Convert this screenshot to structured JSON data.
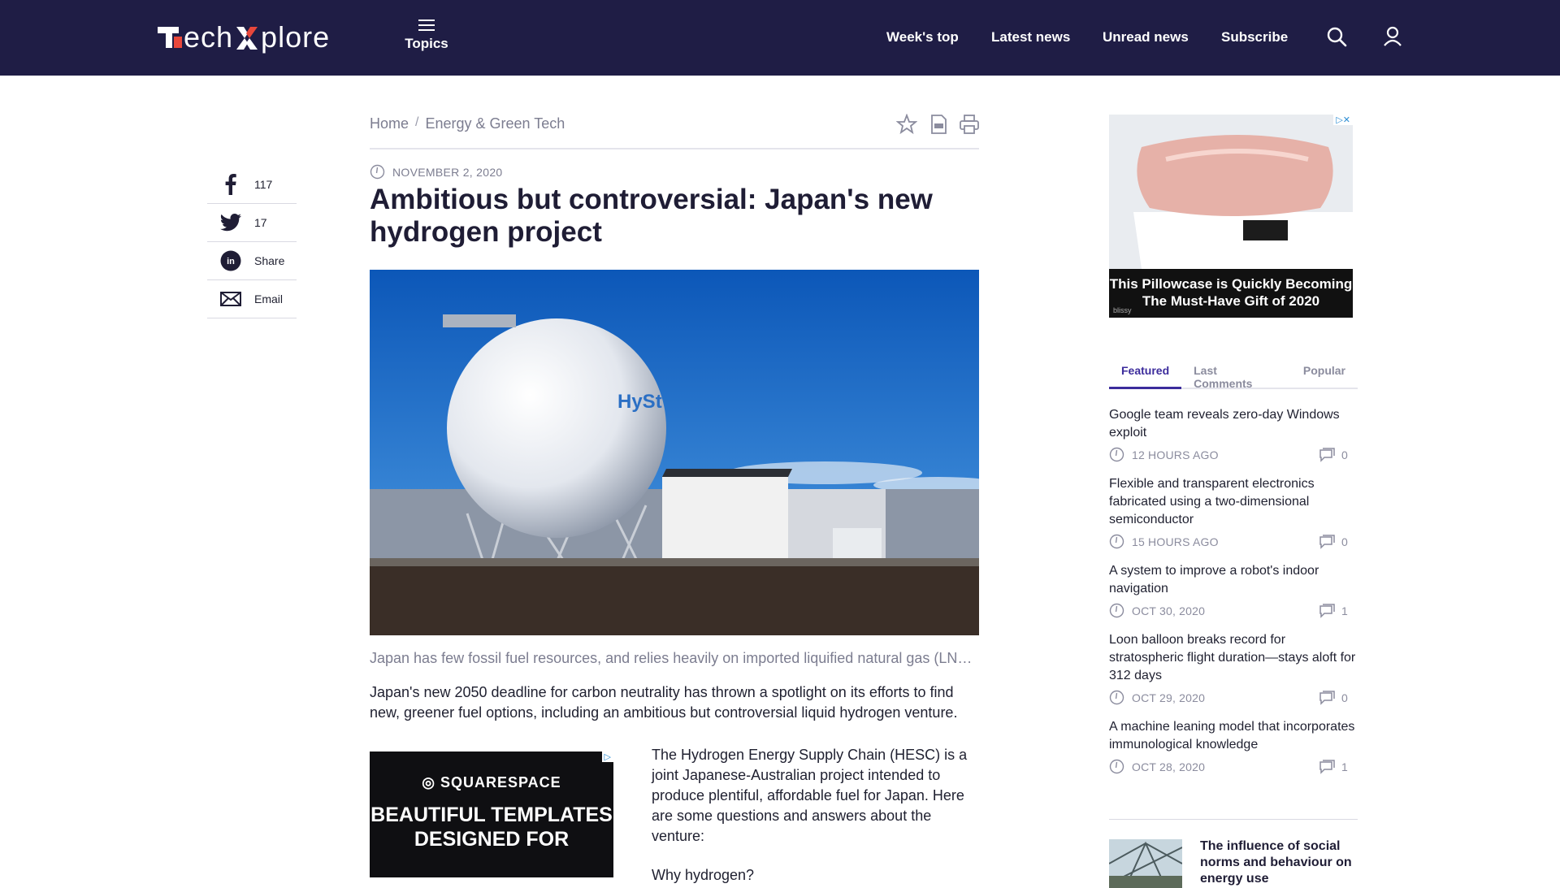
{
  "header": {
    "logo": {
      "part1": "ech",
      "part2": "plore"
    },
    "topics_label": "Topics",
    "nav": [
      "Week's top",
      "Latest news",
      "Unread news",
      "Subscribe"
    ]
  },
  "breadcrumb": {
    "home": "Home",
    "sep": "/",
    "section": "Energy & Green Tech"
  },
  "share": [
    {
      "icon": "facebook-icon",
      "label": "117"
    },
    {
      "icon": "twitter-icon",
      "label": "17"
    },
    {
      "icon": "linkedin-icon",
      "label": "Share"
    },
    {
      "icon": "email-icon",
      "label": "Email"
    }
  ],
  "article": {
    "date": "NOVEMBER 2, 2020",
    "title": "Ambitious but controversial: Japan's new hydrogen project",
    "caption": "Japan has few fossil fuel resources, and relies heavily on imported liquified natural gas (LNG), coal and oil",
    "lead": "Japan's new 2050 deadline for carbon neutrality has thrown a spotlight on its efforts to find new, greener fuel options, including an ambitious but controversial liquid hydrogen venture.",
    "body": "The Hydrogen Energy Supply Chain (HESC) is a joint Japanese-Australian project intended to produce plentiful, affordable fuel for Japan. Here are some questions and answers about the venture:",
    "body_next": "Why hydrogen?",
    "hero_tank_text": "HySt"
  },
  "ads": {
    "sidebar": {
      "caption": "This Pillowcase is Quickly Becoming The Must-Have Gift of 2020",
      "brand_small": "blissy"
    },
    "inline": {
      "brand": "SQUARESPACE",
      "headline": "BEAUTIFUL TEMPLATES DESIGNED FOR"
    }
  },
  "sidebar": {
    "tabs": [
      "Featured",
      "Last Comments",
      "Popular"
    ],
    "items": [
      {
        "title": "Google team reveals zero-day Windows exploit",
        "date": "12 HOURS AGO",
        "comments": "0"
      },
      {
        "title": "Flexible and transparent electronics fabricated using a two-dimensional semiconductor",
        "date": "15 HOURS AGO",
        "comments": "0"
      },
      {
        "title": "A system to improve a robot's indoor navigation",
        "date": "OCT 30, 2020",
        "comments": "1"
      },
      {
        "title": "Loon balloon breaks record for stratospheric flight duration—stays aloft for 312 days",
        "date": "OCT 29, 2020",
        "comments": "0"
      },
      {
        "title": "A machine leaning model that incorporates immunological knowledge",
        "date": "OCT 28, 2020",
        "comments": "1"
      }
    ],
    "promo_title": "The influence of social norms and behaviour on energy use"
  },
  "colors": {
    "header_bg": "#1f1d45",
    "accent": "#3c2c9c",
    "logo_red": "#e8473b"
  }
}
